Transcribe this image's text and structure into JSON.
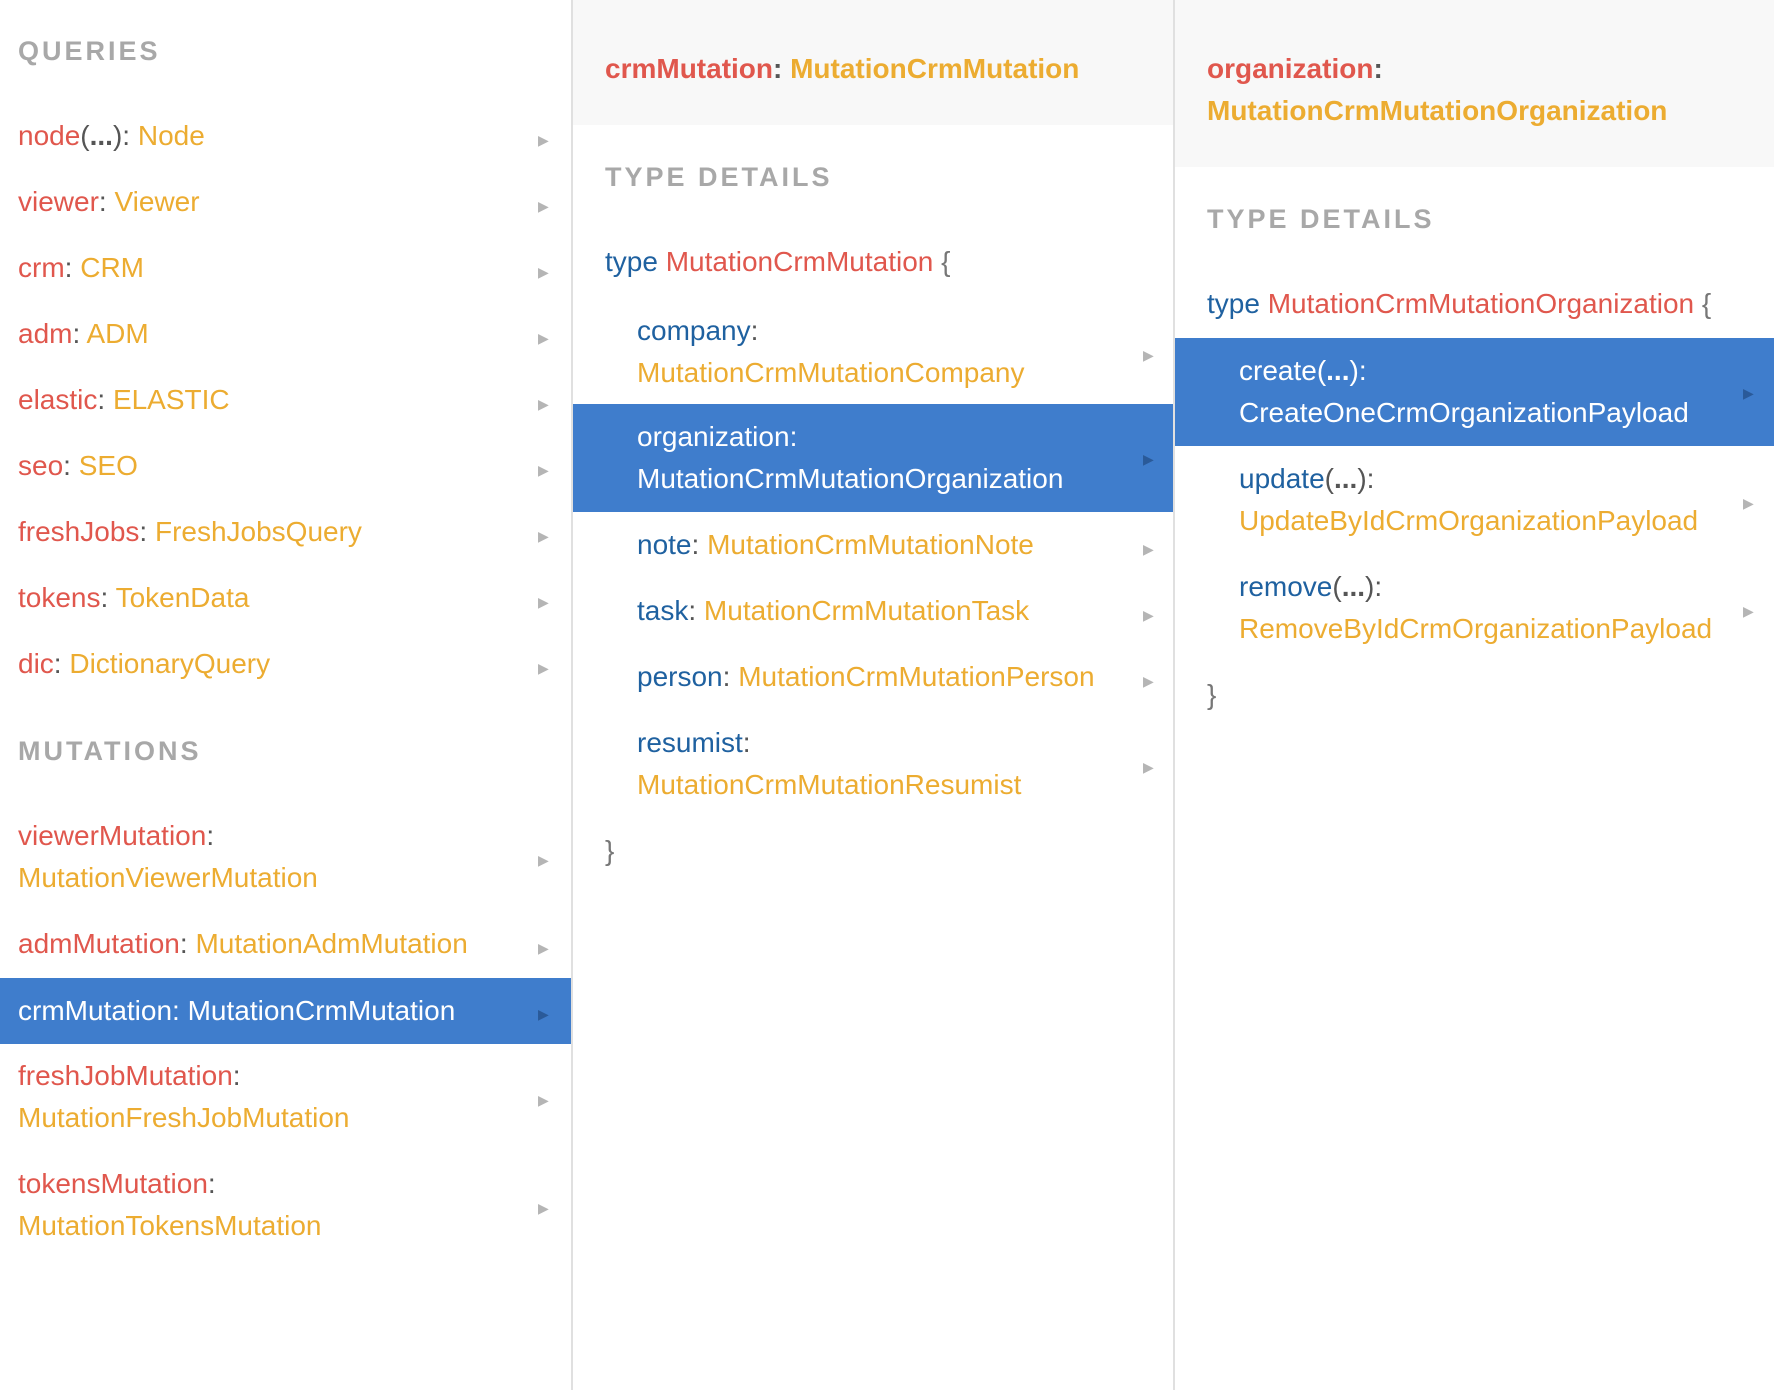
{
  "queries_panel": {
    "queries_title": "QUERIES",
    "queries": [
      {
        "name": "node",
        "args": "...",
        "type": "Node"
      },
      {
        "name": "viewer",
        "type": "Viewer"
      },
      {
        "name": "crm",
        "type": "CRM"
      },
      {
        "name": "adm",
        "type": "ADM"
      },
      {
        "name": "elastic",
        "type": "ELASTIC"
      },
      {
        "name": "seo",
        "type": "SEO"
      },
      {
        "name": "freshJobs",
        "type": "FreshJobsQuery"
      },
      {
        "name": "tokens",
        "type": "TokenData"
      },
      {
        "name": "dic",
        "type": "DictionaryQuery"
      }
    ],
    "mutations_title": "MUTATIONS",
    "mutations": [
      {
        "name": "viewerMutation",
        "type": "MutationViewerMutation"
      },
      {
        "name": "admMutation",
        "type": "MutationAdmMutation"
      },
      {
        "name": "crmMutation",
        "type": "MutationCrmMutation",
        "selected": true
      },
      {
        "name": "freshJobMutation",
        "type": "MutationFreshJobMutation"
      },
      {
        "name": "tokensMutation",
        "type": "MutationTokensMutation"
      }
    ]
  },
  "type_panel": {
    "header_field": "crmMutation",
    "header_type": "MutationCrmMutation",
    "section_title": "TYPE DETAILS",
    "type_keyword": "type",
    "type_name": "MutationCrmMutation",
    "open_brace": "{",
    "close_brace": "}",
    "fields": [
      {
        "name": "company",
        "type": "MutationCrmMutationCompany"
      },
      {
        "name": "organization",
        "type": "MutationCrmMutationOrganization",
        "selected": true
      },
      {
        "name": "note",
        "type": "MutationCrmMutationNote"
      },
      {
        "name": "task",
        "type": "MutationCrmMutationTask"
      },
      {
        "name": "person",
        "type": "MutationCrmMutationPerson"
      },
      {
        "name": "resumist",
        "type": "MutationCrmMutationResumist"
      }
    ]
  },
  "org_panel": {
    "header_field": "organization",
    "header_type": "MutationCrmMutationOrganization",
    "section_title": "TYPE DETAILS",
    "type_keyword": "type",
    "type_name": "MutationCrmMutationOrganization",
    "open_brace": "{",
    "close_brace": "}",
    "fields": [
      {
        "name": "create",
        "args": "...",
        "type": "CreateOneCrmOrganizationPayload",
        "selected": true
      },
      {
        "name": "update",
        "args": "...",
        "type": "UpdateByIdCrmOrganizationPayload"
      },
      {
        "name": "remove",
        "args": "...",
        "type": "RemoveByIdCrmOrganizationPayload"
      }
    ]
  },
  "symbols": {
    "arrow": "▶",
    "colon": ":",
    "open_paren": "(",
    "close_paren_colon": "):"
  },
  "colors": {
    "field": "#e0574d",
    "type": "#ecac31",
    "keyword": "#1f61a0",
    "selected_bg": "#3f7dcc",
    "section_title": "#a8a8a8",
    "header_bg": "#f8f8f8"
  }
}
